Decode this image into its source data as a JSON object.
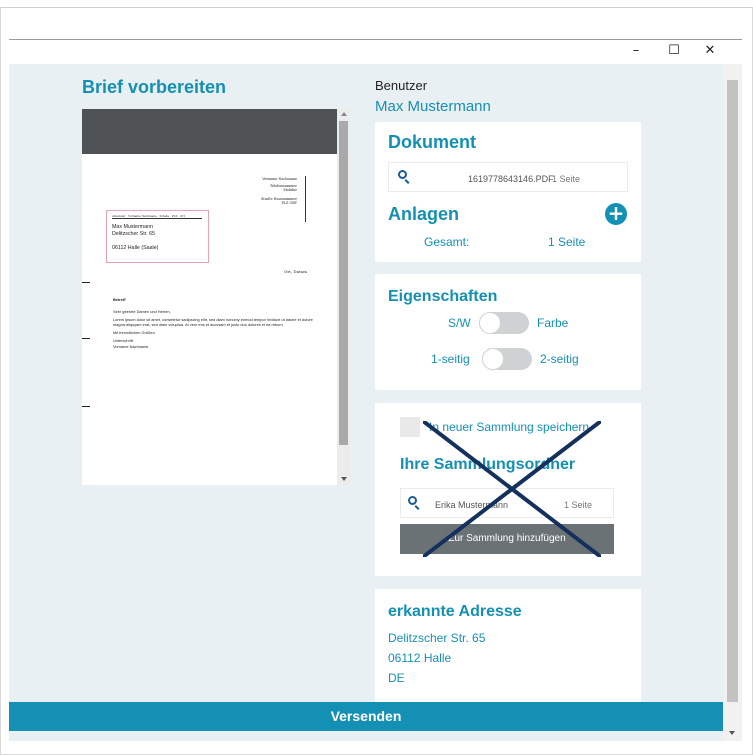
{
  "window": {
    "minimize": "–",
    "maximize": "☐",
    "close": "✕"
  },
  "left": {
    "title": "Brief vorbereiten"
  },
  "preview": {
    "sender": [
      "Vorname Nachname",
      "Telefonnummer",
      "Mobilnr",
      "Straße Hausnummer",
      "PLZ ORT"
    ],
    "return_address": "Absender · Vorname Nachname · Straße · PLZ · Ort",
    "recipient": [
      "Max Mustermann",
      "Delitzscher Str. 65",
      "",
      "06112 Halle (Saale)"
    ],
    "date": "Ort, Datum",
    "subject": "Betreff",
    "salutation": "Sehr geehrte Damen und Herren,",
    "body": "Lorem ipsum dolor sit amet, consetetur sadipscing elitr, sed diam nonumy eirmod tempor invidunt ut labore et dolore magna aliquyam erat, sed diam voluptua. At vero eos et accusam et justo duo dolores et ea rebum.",
    "closing": "Mit freundlichen Grüßen",
    "signature": "Unterschrift",
    "signer": "Vorname Nachname"
  },
  "user": {
    "label": "Benutzer",
    "name": "Max Mustermann"
  },
  "dokument": {
    "heading": "Dokument",
    "file": "1619778643146.PDF",
    "pages": "1 Seite"
  },
  "anlagen": {
    "heading": "Anlagen",
    "total_label": "Gesamt:",
    "total_value": "1 Seite"
  },
  "eigenschaften": {
    "heading": "Eigenschaften",
    "color_left": "S/W",
    "color_right": "Farbe",
    "side_left": "1-seitig",
    "side_right": "2-seitig"
  },
  "sammlung": {
    "checkbox_label": "In neuer Sammlung speichern",
    "heading": "Ihre Sammlungsordner",
    "folder_name": "Erika Mustermann",
    "folder_pages": "1 Seite",
    "add_button": "Zur Sammlung hinzufügen",
    "cross_color": "#14305d"
  },
  "adresse": {
    "heading": "erkannte Adresse",
    "lines": [
      "Delitzscher Str. 65",
      "06112 Halle",
      "DE"
    ]
  },
  "footer": {
    "send": "Versenden"
  },
  "colors": {
    "accent": "#1590b5",
    "background": "#e9f0f3"
  }
}
